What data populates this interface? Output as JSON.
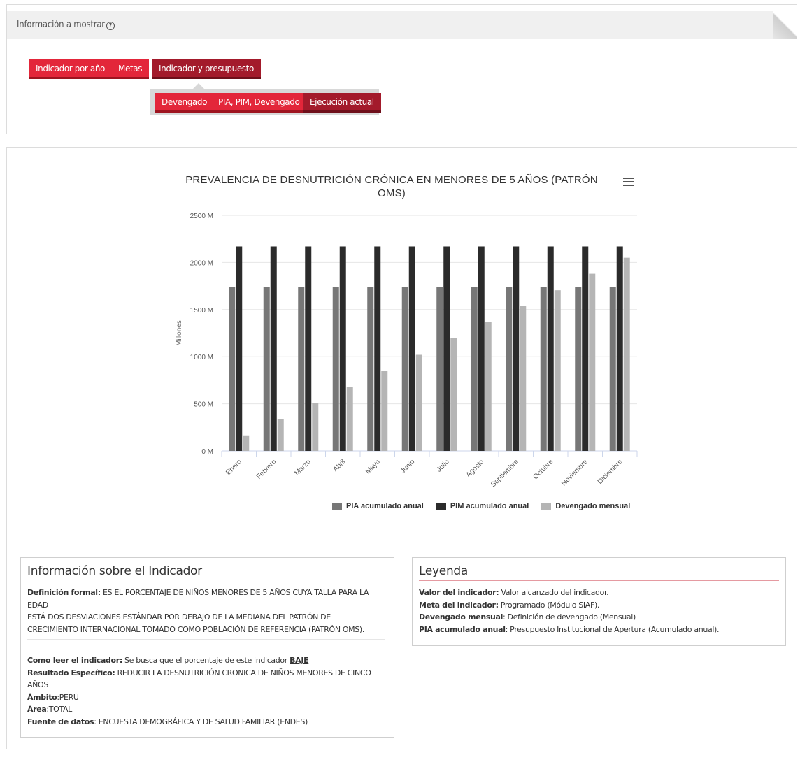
{
  "panel": {
    "title": "Información a mostrar",
    "help_icon": "help-circle-icon"
  },
  "tabs": [
    {
      "label": "Indicador por año",
      "active": false
    },
    {
      "label": "Metas",
      "active": false
    },
    {
      "label": "Indicador y presupuesto",
      "active": true
    }
  ],
  "subtabs": [
    {
      "label": "Devengado",
      "active": false
    },
    {
      "label": "PIA, PIM, Devengado",
      "active": false
    },
    {
      "label": "Ejecución actual",
      "active": true
    }
  ],
  "colors": {
    "accent": "#e3263a",
    "accent_dark": "#a31a2b",
    "pia": "#777777",
    "pim": "#2b2b2b",
    "devengado": "#b5b5b5"
  },
  "chart_data": {
    "type": "bar",
    "title": "PREVALENCIA DE DESNUTRICIÓN CRÓNICA EN MENORES DE 5 AÑOS (PATRÓN OMS)",
    "ylabel": "Millones",
    "ylim": [
      0,
      2500
    ],
    "yticks": [
      0,
      500,
      1000,
      1500,
      2000,
      2500
    ],
    "ytick_labels": [
      "0 M",
      "500 M",
      "1000 M",
      "1500 M",
      "2000 M",
      "2500 M"
    ],
    "categories": [
      "Enero",
      "Febrero",
      "Marzo",
      "Abril",
      "Mayo",
      "Junio",
      "Julio",
      "Agosto",
      "Septiembre",
      "Octubre",
      "Noviembre",
      "Diciembre"
    ],
    "series": [
      {
        "name": "PIA acumulado anual",
        "values": [
          1740,
          1740,
          1740,
          1740,
          1740,
          1740,
          1740,
          1740,
          1740,
          1740,
          1740,
          1740
        ]
      },
      {
        "name": "PIM acumulado anual",
        "values": [
          2170,
          2170,
          2170,
          2170,
          2170,
          2170,
          2170,
          2170,
          2170,
          2170,
          2170,
          2170
        ]
      },
      {
        "name": "Devengado mensual",
        "values": [
          165,
          340,
          510,
          680,
          850,
          1020,
          1195,
          1370,
          1540,
          1705,
          1880,
          2050
        ]
      }
    ],
    "grid": true,
    "legend_position": "bottom-right",
    "menu_icon": "hamburger-menu-icon"
  },
  "indicator_info": {
    "title": "Información sobre el Indicador",
    "definicion_label": "Definición formal:",
    "definicion_lines": [
      "ES EL PORCENTAJE DE NIÑOS MENORES DE 5 AÑOS CUYA TALLA PARA LA EDAD",
      "ESTÁ DOS DESVIACIONES ESTÁNDAR POR DEBAJO DE LA MEDIANA DEL PATRÓN DE",
      "CRECIMIENTO INTERNACIONAL TOMADO COMO POBLACIÓN DE REFERENCIA (PATRÓN OMS)."
    ],
    "como_leer_label": "Como leer el indicador:",
    "como_leer_text": "Se busca que el porcentaje de este indicador",
    "como_leer_link": "BAJE",
    "resultado_label": "Resultado Específico:",
    "resultado_line1": "REDUCIR LA DESNUTRICIÓN CRONICA DE NIÑOS MENORES DE CINCO",
    "resultado_line2": "AÑOS",
    "ambito_label": "Ámbito",
    "ambito_value": ":PERÚ",
    "area_label": "Área",
    "area_value": ":TOTAL",
    "fuente_label": "Fuente de datos",
    "fuente_value": ": ENCUESTA DEMOGRÁFICA Y DE SALUD FAMILIAR (ENDES)"
  },
  "leyenda": {
    "title": "Leyenda",
    "items": [
      {
        "label": "Valor del indicador:",
        "text": " Valor alcanzado del indicador."
      },
      {
        "label": "Meta del indicador:",
        "text": " Programado (Módulo SIAF)."
      },
      {
        "label": "Devengado mensual",
        "text": ": Definición de devengado (Mensual)"
      },
      {
        "label": "PIA acumulado anual",
        "text": ": Presupuesto Institucional de Apertura (Acumulado anual)."
      }
    ]
  }
}
